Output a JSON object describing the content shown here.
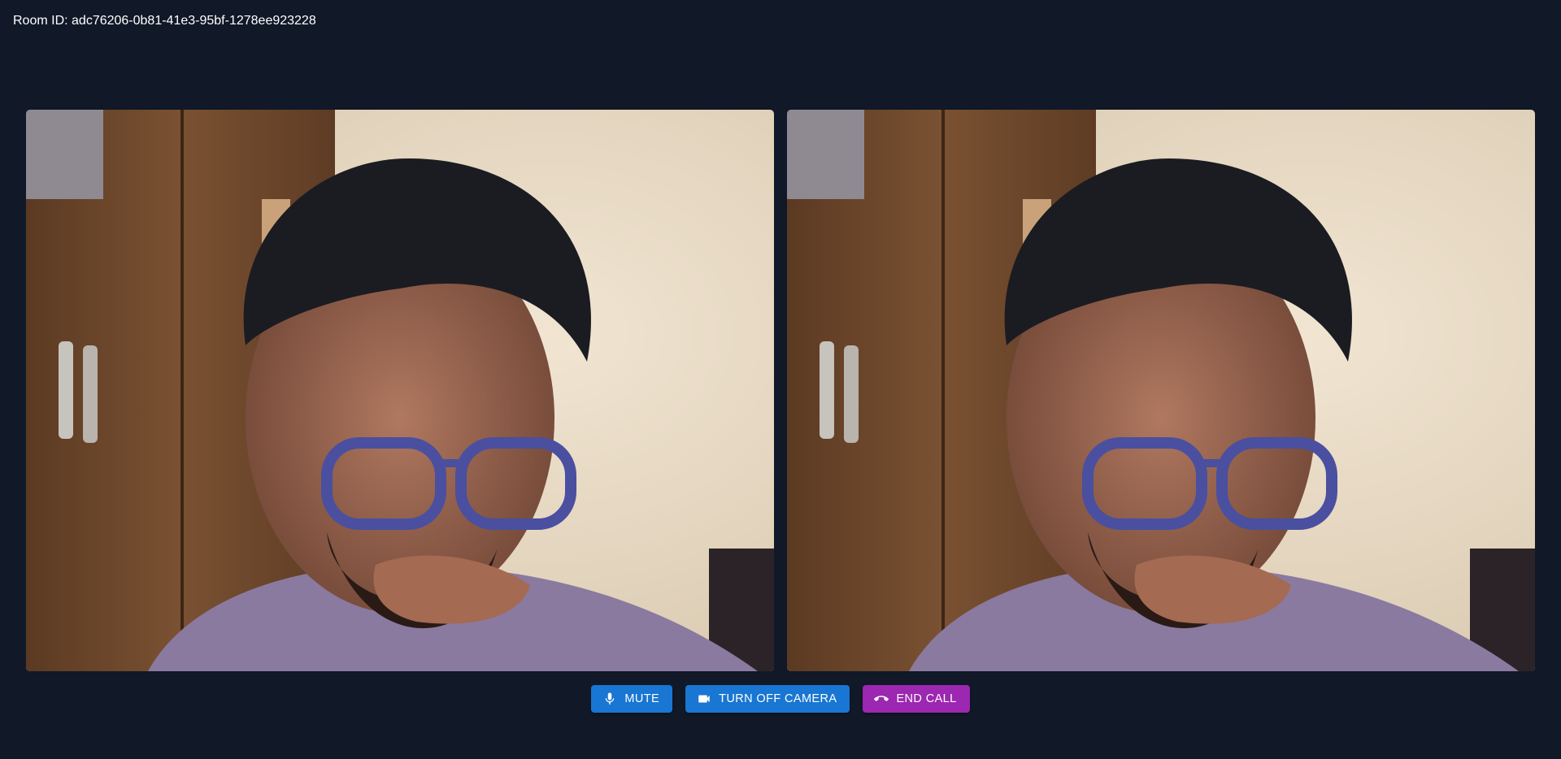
{
  "room": {
    "label": "Room ID: adc76206-0b81-41e3-95bf-1278ee923228"
  },
  "videos": [
    {
      "kind": "local"
    },
    {
      "kind": "remote"
    }
  ],
  "controls": {
    "mute_label": "MUTE",
    "mute_icon": "microphone-icon",
    "camera_label": "TURN OFF CAMERA",
    "camera_icon": "videocam-icon",
    "end_label": "END CALL",
    "end_icon": "call-end-icon"
  },
  "colors": {
    "background": "#111827",
    "primary": "#1976d2",
    "end_call": "#9c27b0"
  }
}
